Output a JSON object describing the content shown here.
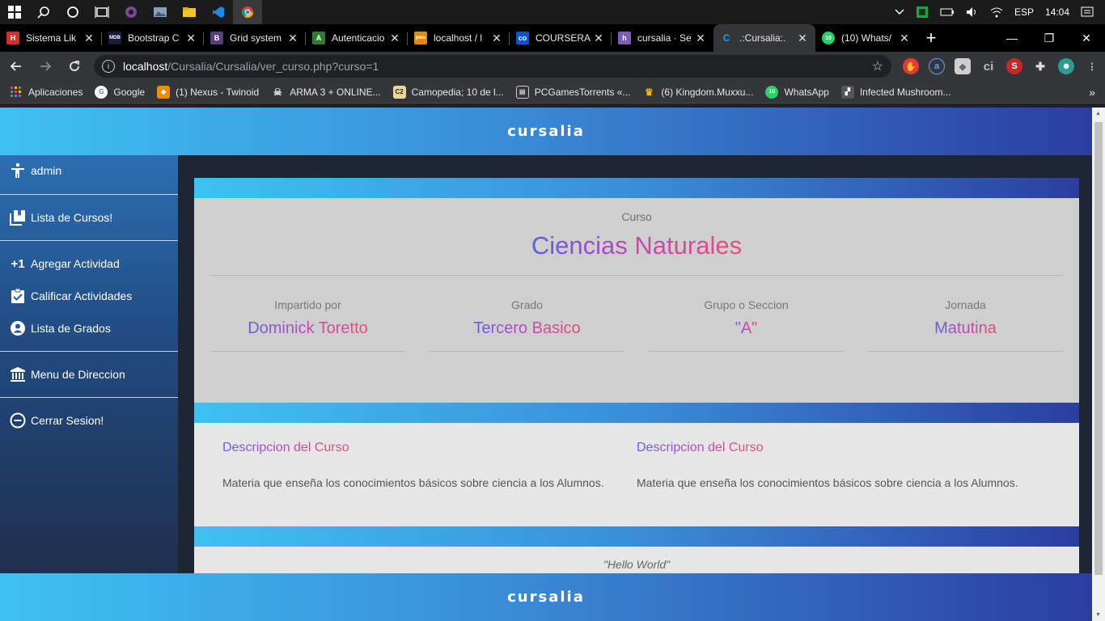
{
  "taskbar": {
    "language": "ESP",
    "time": "14:04"
  },
  "tabs": [
    {
      "title": "Sistema Lik",
      "favicon": "H",
      "color": "#d32f2f"
    },
    {
      "title": "Bootstrap C",
      "favicon": "MDB",
      "color": "#1b1b3a"
    },
    {
      "title": "Grid system",
      "favicon": "B",
      "color": "#563d7c"
    },
    {
      "title": "Autenticacio",
      "favicon": "A",
      "color": "#2e7d32"
    },
    {
      "title": "localhost / l",
      "favicon": "pma",
      "color": "#e58a00"
    },
    {
      "title": "COURSERA",
      "favicon": "co",
      "color": "#0056d2"
    },
    {
      "title": "cursalia · Se",
      "favicon": "h",
      "color": "#7b5cb8"
    },
    {
      "title": ".:Cursalia:.",
      "favicon": "C",
      "color": "#2196f3",
      "active": true
    },
    {
      "title": "(10) Whats/",
      "favicon": "10",
      "color": "#25d366"
    }
  ],
  "address": {
    "host": "localhost",
    "path": "/Cursalia/Cursalia/ver_curso.php?curso=1"
  },
  "bookmarks": [
    {
      "label": "Aplicaciones",
      "color": "#e53935",
      "icon": "grid-icon"
    },
    {
      "label": "Google",
      "color": "#4285f4",
      "icon": "google-icon"
    },
    {
      "label": "(1) Nexus - Twinoid",
      "color": "#f08c00",
      "icon": "nexus-icon"
    },
    {
      "label": "ARMA 3 + ONLINE...",
      "color": "#555555",
      "icon": "skull-icon"
    },
    {
      "label": "Camopedia; 10 de l...",
      "color": "#c8a24a",
      "icon": "c2-icon"
    },
    {
      "label": "PCGamesTorrents «...",
      "color": "#444444",
      "icon": "pcgames-icon"
    },
    {
      "label": "(6) Kingdom.Muxxu...",
      "color": "#d4a017",
      "icon": "crown-icon"
    },
    {
      "label": "WhatsApp",
      "color": "#25d366",
      "icon": "whatsapp-icon"
    },
    {
      "label": "Infected Mushroom...",
      "color": "#666666",
      "icon": "mushroom-icon"
    }
  ],
  "site": {
    "logo": "cursalia",
    "footer_logo": "cursalia"
  },
  "sidebar": {
    "user": "admin",
    "items": [
      {
        "label": "Lista de Cursos!",
        "icon": "library-icon"
      },
      {
        "label": "Agregar Actividad",
        "icon": "plus-one-icon"
      },
      {
        "label": "Calificar Actividades",
        "icon": "clipboard-check-icon"
      },
      {
        "label": "Lista de Grados",
        "icon": "person-icon"
      },
      {
        "label": "Menu de Direccion",
        "icon": "bank-icon"
      },
      {
        "label": "Cerrar Sesion!",
        "icon": "minus-circle-icon"
      }
    ]
  },
  "course": {
    "label": "Curso",
    "name": "Ciencias Naturales",
    "fields": [
      {
        "label": "Impartido por",
        "value": "Dominick Toretto"
      },
      {
        "label": "Grado",
        "value": "Tercero Basico"
      },
      {
        "label": "Grupo o Seccion",
        "value": "\"A\""
      },
      {
        "label": "Jornada",
        "value": "Matutina"
      }
    ],
    "descriptions": [
      {
        "title": "Descripcion del Curso",
        "text": "Materia que enseña los conocimientos básicos sobre ciencia a los Alumnos."
      },
      {
        "title": "Descripcion del Curso",
        "text": "Materia que enseña los conocimientos básicos sobre ciencia a los Alumnos."
      }
    ],
    "quote": "\"Hello World\""
  }
}
